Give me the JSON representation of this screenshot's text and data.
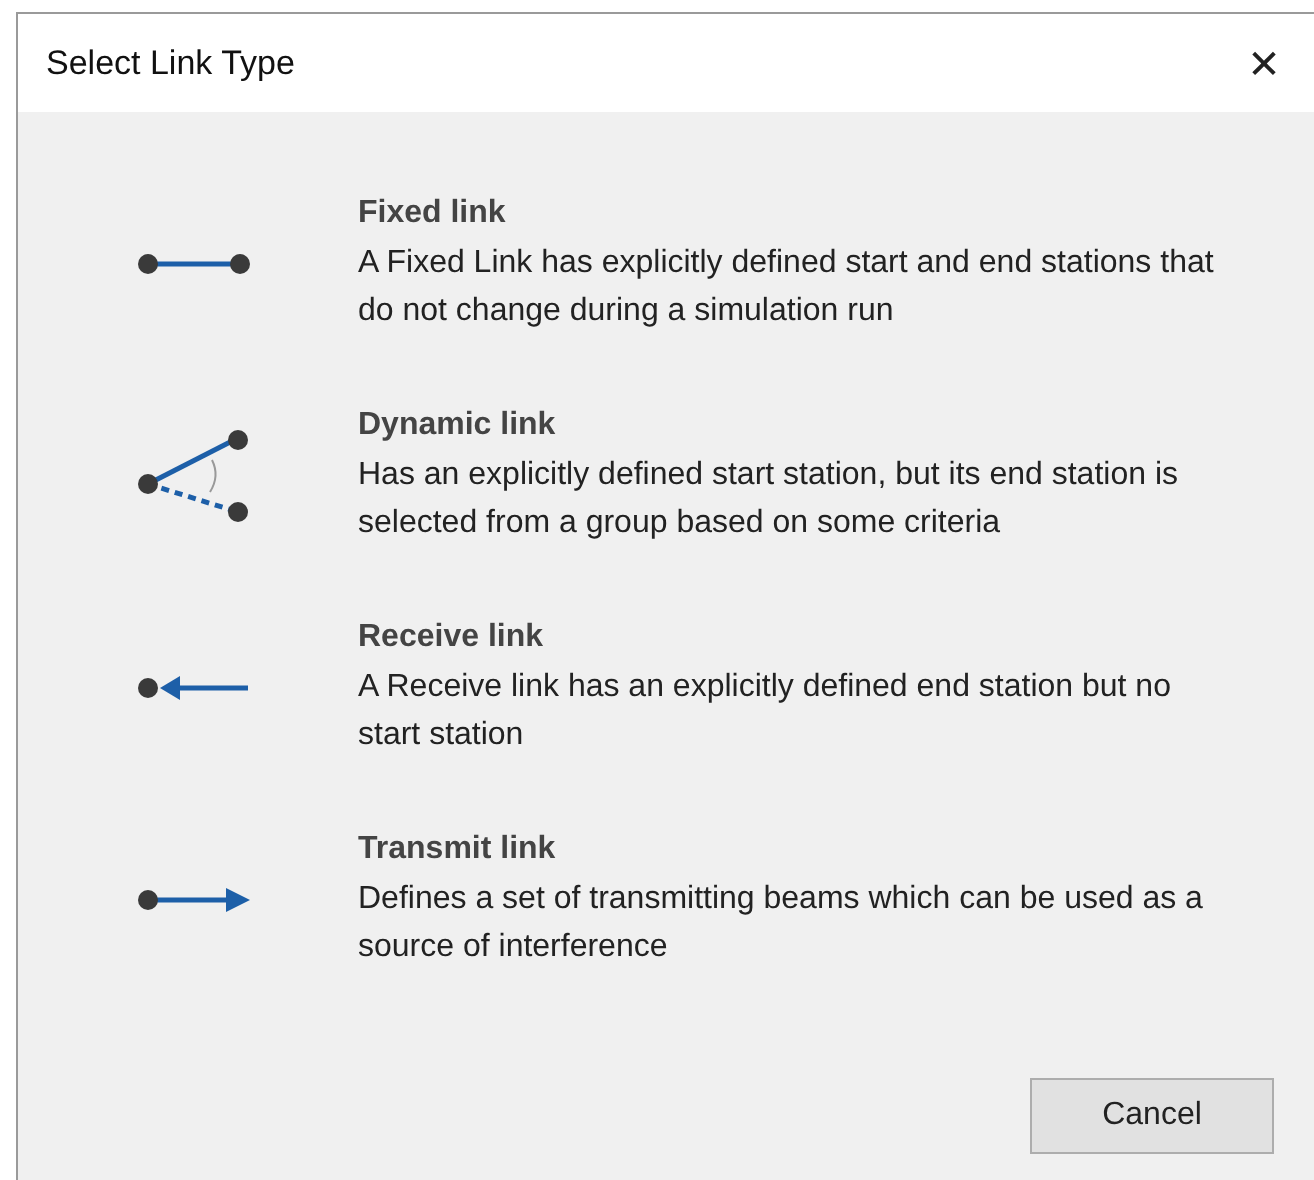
{
  "window": {
    "title": "Select Link Type",
    "close": "✕"
  },
  "link_types": [
    {
      "kind": "fixed",
      "title": "Fixed link",
      "description": "A Fixed Link has explicitly defined start and end stations that do not change during a simulation run"
    },
    {
      "kind": "dynamic",
      "title": "Dynamic link",
      "description": "Has an explicitly defined start station, but its end station is selected from a group based on some criteria"
    },
    {
      "kind": "receive",
      "title": "Receive link",
      "description": "A Receive link has an explicitly defined end station but no start station"
    },
    {
      "kind": "transmit",
      "title": "Transmit link",
      "description": "Defines a set of transmitting beams which can be used as a source of interference"
    }
  ],
  "buttons": [
    "Cancel"
  ]
}
